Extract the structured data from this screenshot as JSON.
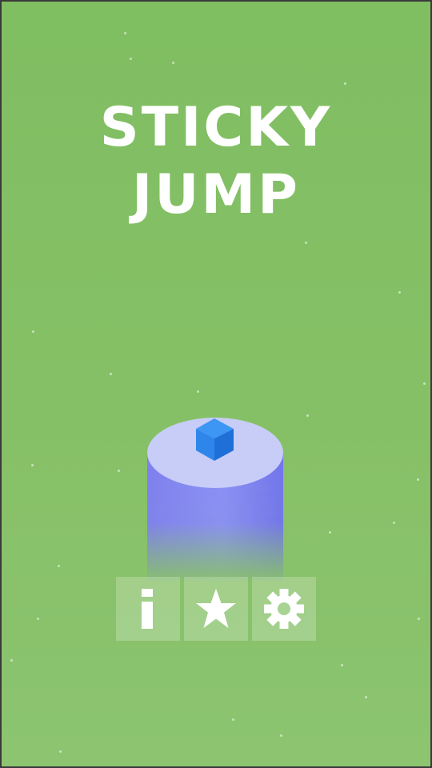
{
  "game": {
    "title_line1": "STICKY",
    "title_line2": "JUMP"
  },
  "menu": {
    "buttons": [
      {
        "id": "info",
        "icon": "info-icon"
      },
      {
        "id": "rate",
        "icon": "star-icon"
      },
      {
        "id": "settings",
        "icon": "gear-icon"
      }
    ]
  },
  "colors": {
    "background": "#82bf64",
    "text": "#ffffff",
    "pillar_top": "#c8cdf8",
    "pillar_side": "#7a7cf2",
    "cube": "#2a7fe8",
    "button_overlay": "rgba(255,255,255,0.22)"
  }
}
